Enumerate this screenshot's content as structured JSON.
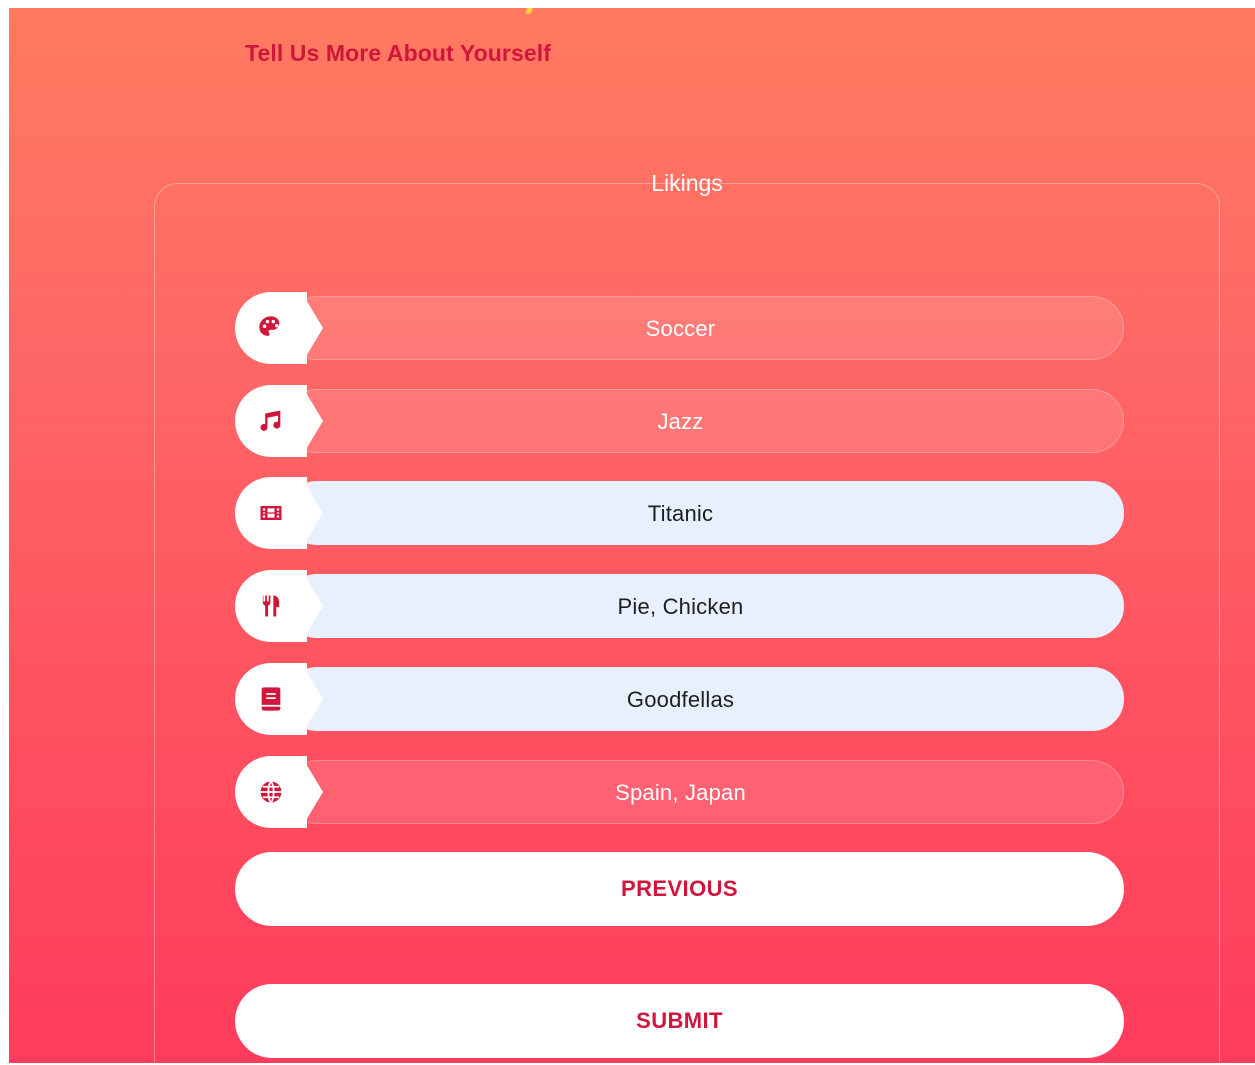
{
  "header": {
    "subtitle": "Tell Us More About Yourself"
  },
  "likings": {
    "legend": "Likings",
    "items": [
      {
        "icon": "palette-icon",
        "value": "Soccer",
        "style": "translucent"
      },
      {
        "icon": "music-note-icon",
        "value": "Jazz",
        "style": "translucent"
      },
      {
        "icon": "film-icon",
        "value": "Titanic",
        "style": "light"
      },
      {
        "icon": "utensils-icon",
        "value": "Pie, Chicken",
        "style": "light"
      },
      {
        "icon": "book-icon",
        "value": "Goodfellas",
        "style": "light"
      },
      {
        "icon": "globe-icon",
        "value": "Spain, Japan",
        "style": "translucent"
      }
    ]
  },
  "buttons": {
    "previous": "PREVIOUS",
    "submit": "SUBMIT"
  },
  "colors": {
    "accent": "#d0163a",
    "gradient_top": "#ff7a60",
    "gradient_bottom": "#ff3c5c",
    "light_field": "#e8f0fd"
  }
}
